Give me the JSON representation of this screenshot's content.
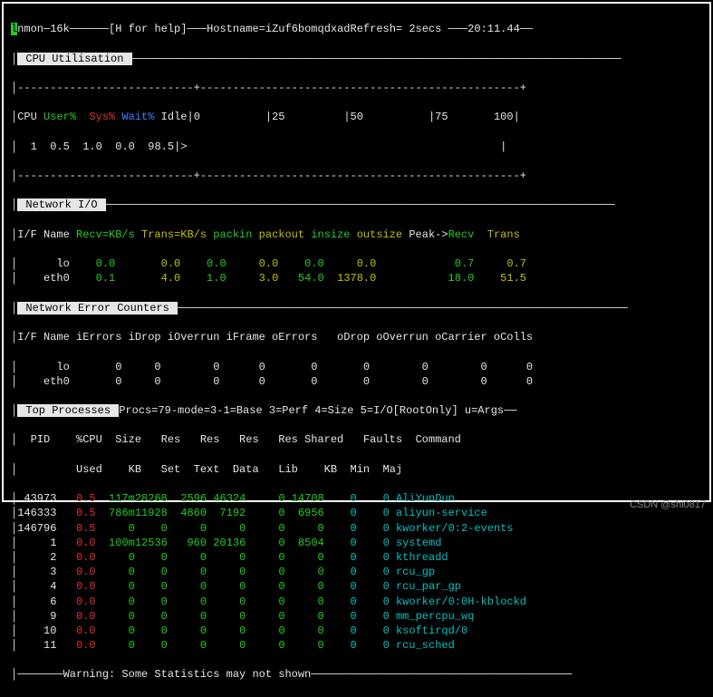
{
  "header": {
    "prog": "nmon",
    "ver": "16k",
    "help": "[H for help]",
    "hostlabel": "Hostname=",
    "hostname": "iZuf6bomqdxad",
    "refreshlabel": "Refresh=",
    "refresh": " 2secs ",
    "time": "20:11.44"
  },
  "cpu": {
    "title": " CPU Utilisation ",
    "hdr_cpu": "CPU",
    "hdr_user": "User%",
    "hdr_sys": "Sys%",
    "hdr_wait": "Wait%",
    "hdr_idle": " Idle",
    "scale0": "0",
    "scale25": "25",
    "scale50": "50",
    "scale75": "75",
    "scale100": "100",
    "row_id": "  1",
    "row_user": "  0.5",
    "row_sys": "  1.0",
    "row_wait": "  0.0",
    "row_idle": "  98.5",
    "bar": ">"
  },
  "net": {
    "title": " Network I/O ",
    "hdr_if": "I/F Name",
    "hdr_recv": "Recv=KB/s",
    "hdr_trans": "Trans=KB/s",
    "hdr_packin": "packin",
    "hdr_packout": "packout",
    "hdr_insize": "insize",
    "hdr_outsize": "outsize",
    "hdr_peak": "Peak->",
    "hdr_precv": "Recv",
    "hdr_ptrans": "Trans",
    "rows": [
      {
        "if": "      lo",
        "recv": "    0.0",
        "trans": "     0.0",
        "pin": "   0.0",
        "pout": "    0.0",
        "ins": "   0.0",
        "outs": "    0.0",
        "prcv": "    0.7",
        "ptrn": "    0.7"
      },
      {
        "if": "    eth0",
        "recv": "    0.1",
        "trans": "     4.0",
        "pin": "   1.0",
        "pout": "    3.0",
        "ins": "  54.0",
        "outs": " 1378.0",
        "prcv": "   18.0",
        "ptrn": "   51.5"
      }
    ]
  },
  "neterr": {
    "title": " Network Error Counters ",
    "hdr": "I/F Name iErrors iDrop iOverrun iFrame oErrors   oDrop oOverrun oCarrier oColls",
    "rows": [
      {
        "if": "      lo",
        "v": "       0     0        0      0       0       0        0        0      0"
      },
      {
        "if": "    eth0",
        "v": "       0     0        0      0       0       0        0        0      0"
      }
    ]
  },
  "top": {
    "title": " Top Processes ",
    "subtitle": "Procs=79-mode=3-1=Base 3=Perf 4=Size 5=I/O[RootOnly] u=Args",
    "hdr1": "  PID    %CPU  Size   Res   Res   Res   Res Shared   Faults  Command",
    "hdr2": "         Used    KB   Set  Text  Data   Lib    KB  Min  Maj",
    "rows": [
      {
        "pid": " 43973",
        "cpu": "   0.5",
        "size": "  117m",
        "res": "28268",
        "set": "  2596",
        "text": " 46324",
        "data": "     0",
        "lib": " 14708",
        "min": "    0",
        "maj": "    0",
        "cmd": " AliYunDun"
      },
      {
        "pid": "146333",
        "cpu": "   0.5",
        "size": "  786m",
        "res": "11928",
        "set": "  4860",
        "text": "  7192",
        "data": "     0",
        "lib": "  6956",
        "min": "    0",
        "maj": "    0",
        "cmd": " aliyun-service"
      },
      {
        "pid": "146796",
        "cpu": "   0.5",
        "size": "     0",
        "res": "    0",
        "set": "     0",
        "text": "     0",
        "data": "     0",
        "lib": "     0",
        "min": "    0",
        "maj": "    0",
        "cmd": " kworker/0:2-events"
      },
      {
        "pid": "     1",
        "cpu": "   0.0",
        "size": "  100m",
        "res": "12536",
        "set": "   960",
        "text": " 20136",
        "data": "     0",
        "lib": "  8504",
        "min": "    0",
        "maj": "    0",
        "cmd": " systemd"
      },
      {
        "pid": "     2",
        "cpu": "   0.0",
        "size": "     0",
        "res": "    0",
        "set": "     0",
        "text": "     0",
        "data": "     0",
        "lib": "     0",
        "min": "    0",
        "maj": "    0",
        "cmd": " kthreadd"
      },
      {
        "pid": "     3",
        "cpu": "   0.0",
        "size": "     0",
        "res": "    0",
        "set": "     0",
        "text": "     0",
        "data": "     0",
        "lib": "     0",
        "min": "    0",
        "maj": "    0",
        "cmd": " rcu_gp"
      },
      {
        "pid": "     4",
        "cpu": "   0.0",
        "size": "     0",
        "res": "    0",
        "set": "     0",
        "text": "     0",
        "data": "     0",
        "lib": "     0",
        "min": "    0",
        "maj": "    0",
        "cmd": " rcu_par_gp"
      },
      {
        "pid": "     6",
        "cpu": "   0.0",
        "size": "     0",
        "res": "    0",
        "set": "     0",
        "text": "     0",
        "data": "     0",
        "lib": "     0",
        "min": "    0",
        "maj": "    0",
        "cmd": " kworker/0:0H-kblockd"
      },
      {
        "pid": "     9",
        "cpu": "   0.0",
        "size": "     0",
        "res": "    0",
        "set": "     0",
        "text": "     0",
        "data": "     0",
        "lib": "     0",
        "min": "    0",
        "maj": "    0",
        "cmd": " mm_percpu_wq"
      },
      {
        "pid": "    10",
        "cpu": "   0.0",
        "size": "     0",
        "res": "    0",
        "set": "     0",
        "text": "     0",
        "data": "     0",
        "lib": "     0",
        "min": "    0",
        "maj": "    0",
        "cmd": " ksoftirqd/0"
      },
      {
        "pid": "    11",
        "cpu": "   0.0",
        "size": "     0",
        "res": "    0",
        "set": "     0",
        "text": "     0",
        "data": "     0",
        "lib": "     0",
        "min": "    0",
        "maj": "    0",
        "cmd": " rcu_sched"
      }
    ],
    "warning": "Warning: Some Statistics may not shown"
  },
  "watermark": "CSDN @shi0817"
}
